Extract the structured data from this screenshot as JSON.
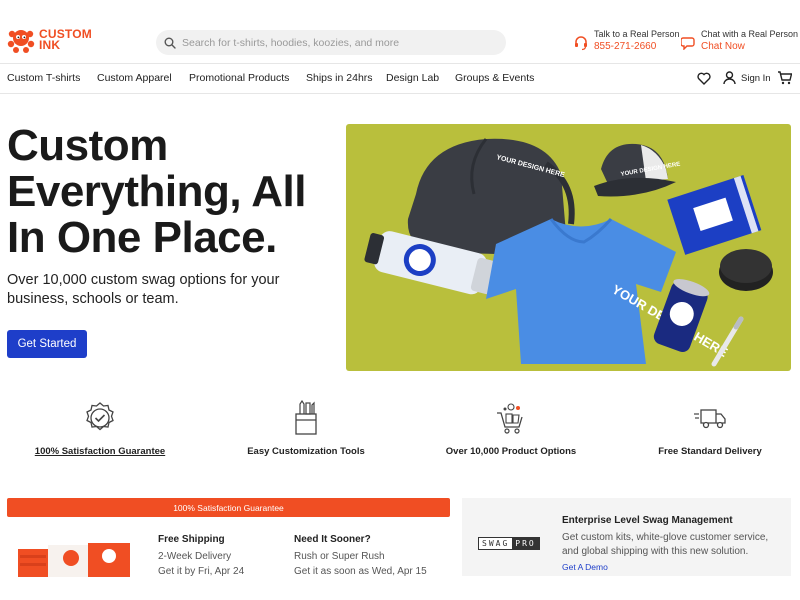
{
  "brand": {
    "logo_text_line1": "CUSTOM",
    "logo_text_line2": "INK",
    "accent": "#f04e23",
    "primary_button": "#1e3ec9"
  },
  "search": {
    "placeholder": "Search for t-shirts, hoodies, koozies, and more",
    "icon": "search-icon"
  },
  "contact": {
    "phone_label": "Talk to a Real Person",
    "phone_value": "855-271-2660",
    "chat_label": "Chat with a Real Person",
    "chat_value": "Chat Now"
  },
  "nav": {
    "items": [
      "Custom T-shirts",
      "Custom Apparel",
      "Promotional Products",
      "Ships in 24hrs",
      "Design Lab",
      "Groups & Events"
    ],
    "signin": "Sign In",
    "icons": [
      "heart-icon",
      "user-icon",
      "cart-icon"
    ]
  },
  "hero": {
    "title": "Custom Everything, All In One Place.",
    "subtitle": "Over 10,000 custom swag options for your business, schools or team.",
    "cta": "Get Started",
    "image_texts": [
      "YOUR DESIGN HERE",
      "YOUR DESIGN HERE",
      "YOUR DESIGN HERE",
      "YOUR DESIGN HERE"
    ]
  },
  "features": [
    {
      "label": "100% Satisfaction Guarantee",
      "icon": "badge-check-icon"
    },
    {
      "label": "Easy Customization Tools",
      "icon": "design-tools-icon"
    },
    {
      "label": "Over 10,000 Product Options",
      "icon": "cart-products-icon"
    },
    {
      "label": "Free Standard Delivery",
      "icon": "delivery-truck-icon"
    }
  ],
  "promo": {
    "bar": "100% Satisfaction Guarantee",
    "free_shipping_title": "Free Shipping",
    "free_shipping_line1": "2-Week Delivery",
    "free_shipping_line2": "Get it by Fri, Apr 24",
    "sooner_title": "Need It Sooner?",
    "sooner_line1": "Rush or Super Rush",
    "sooner_line2": "Get it as soon as Wed, Apr 15"
  },
  "enterprise": {
    "logo_a": "SWAG",
    "logo_b": "PRO",
    "title": "Enterprise Level Swag Management",
    "desc": "Get custom kits, white-glove customer service, and global shipping with this new solution.",
    "link": "Get A Demo"
  }
}
